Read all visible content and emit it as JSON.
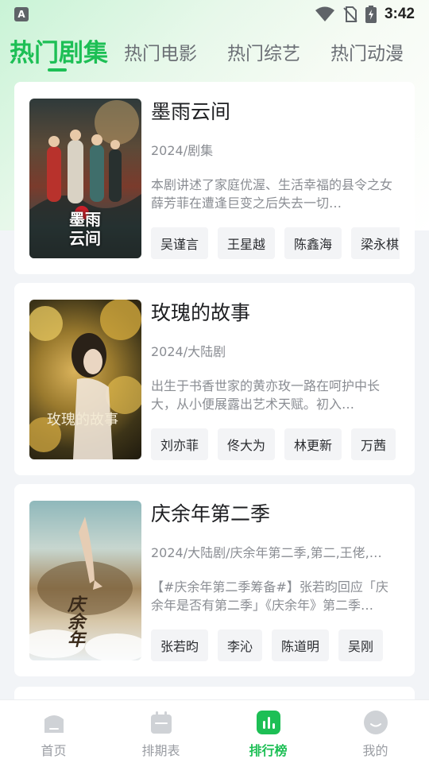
{
  "status_bar": {
    "app_icon_letter": "A",
    "time": "3:42"
  },
  "tabs": [
    {
      "label": "热门剧集",
      "active": true
    },
    {
      "label": "热门电影",
      "active": false
    },
    {
      "label": "热门综艺",
      "active": false
    },
    {
      "label": "热门动漫",
      "active": false
    }
  ],
  "cards": [
    {
      "title": "墨雨云间",
      "meta": "2024/剧集",
      "description": "本剧讲述了家庭优渥、生活幸福的县令之女薛芳菲在遭逢巨变之后失去一切…",
      "poster_art_text": "墨雨云间",
      "cast": [
        "吴谨言",
        "王星越",
        "陈鑫海",
        "梁永棋"
      ]
    },
    {
      "title": "玫瑰的故事",
      "meta": "2024/大陆剧",
      "description": "出生于书香世家的黄亦玫一路在呵护中长大，从小便展露出艺术天赋。初入…",
      "poster_art_text": "玫瑰的故事",
      "cast": [
        "刘亦菲",
        "佟大为",
        "林更新",
        "万茜"
      ]
    },
    {
      "title": "庆余年第二季",
      "meta": "2024/大陆剧/庆余年第二季,第二,王佬,…",
      "description": "【#庆余年第二季筹备#】张若昀回应「庆余年是否有第二季」《庆余年》第二季…",
      "poster_art_text": "庆余年",
      "cast": [
        "张若昀",
        "李沁",
        "陈道明",
        "吴刚"
      ]
    }
  ],
  "bottom_nav": [
    {
      "label": "首页",
      "icon": "home-icon",
      "active": false
    },
    {
      "label": "排期表",
      "icon": "calendar-icon",
      "active": false
    },
    {
      "label": "排行榜",
      "icon": "chart-icon",
      "active": true
    },
    {
      "label": "我的",
      "icon": "profile-icon",
      "active": false
    }
  ],
  "colors": {
    "accent": "#1dbf55",
    "inactive_text": "#6b6f75",
    "muted_text": "#8a8d93"
  }
}
